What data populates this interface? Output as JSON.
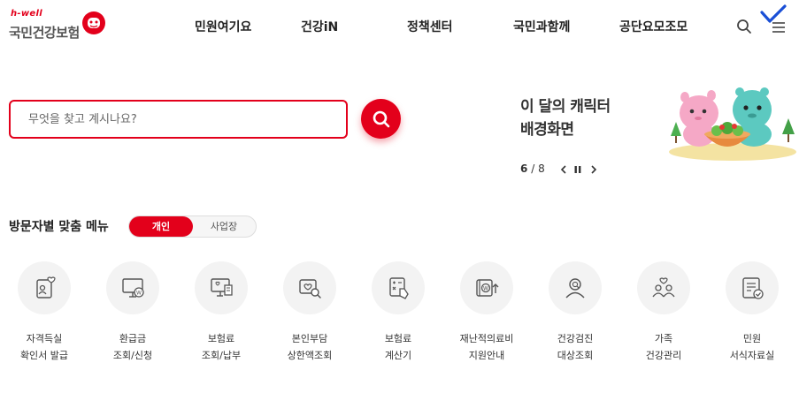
{
  "logo": {
    "tagline": "h-well",
    "name": "국민건강보험"
  },
  "nav": {
    "items": [
      "민원여기요",
      "건강iN",
      "정책센터",
      "국민과함께",
      "공단요모조모"
    ]
  },
  "header_icons": {
    "search": "search-icon",
    "menu": "hamburger-menu-icon"
  },
  "search": {
    "placeholder": "무엇을 찾고 계시나요?",
    "value": ""
  },
  "banner": {
    "title_line1": "이 달의 캐릭터",
    "title_line2": "배경화면",
    "current": "6",
    "separator": "/",
    "total": "8"
  },
  "visitor_menu": {
    "title": "방문자별 맞춤 메뉴",
    "toggle": {
      "active": "개인",
      "inactive": "사업장"
    },
    "items": [
      {
        "line1": "자격득실",
        "line2": "확인서 발급",
        "icon": "id-card-heart-icon"
      },
      {
        "line1": "환급금",
        "line2": "조회/신청",
        "icon": "monitor-won-icon"
      },
      {
        "line1": "보험료",
        "line2": "조회/납부",
        "icon": "monitor-receipt-icon"
      },
      {
        "line1": "본인부담",
        "line2": "상한액조회",
        "icon": "heart-search-icon"
      },
      {
        "line1": "보험료",
        "line2": "계산기",
        "icon": "calculator-hand-icon"
      },
      {
        "line1": "재난적의료비",
        "line2": "지원안내",
        "icon": "wallet-won-up-icon"
      },
      {
        "line1": "건강검진",
        "line2": "대상조회",
        "icon": "person-search-icon"
      },
      {
        "line1": "가족",
        "line2": "건강관리",
        "icon": "family-heart-icon"
      },
      {
        "line1": "민원",
        "line2": "서식자료실",
        "icon": "document-check-icon"
      }
    ]
  },
  "colors": {
    "brand_red": "#e3001b",
    "annotation_blue": "#1a4fd6",
    "icon_gray": "#555555",
    "circle_bg": "#f3f3f3"
  }
}
